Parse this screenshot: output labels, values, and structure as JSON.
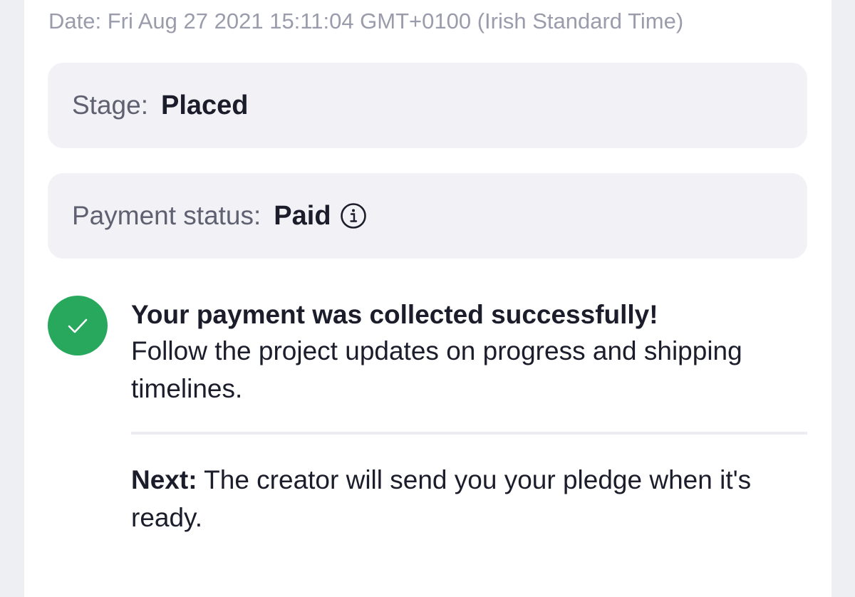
{
  "order": {
    "date_text": "Date: Fri Aug 27 2021 15:11:04 GMT+0100 (Irish Standard Time)",
    "stage_label": "Stage:",
    "stage_value": "Placed",
    "payment_label": "Payment status:",
    "payment_value": "Paid",
    "payment_info_icon": "info-circle-icon"
  },
  "notice": {
    "icon": "check-circle-icon",
    "accent_color": "#27a85d",
    "title": "Your payment was collected successfully!",
    "body": "Follow the project updates on progress and shipping timelines."
  },
  "next": {
    "label": "Next:",
    "text": " The creator will send you your pledge when it's ready."
  }
}
